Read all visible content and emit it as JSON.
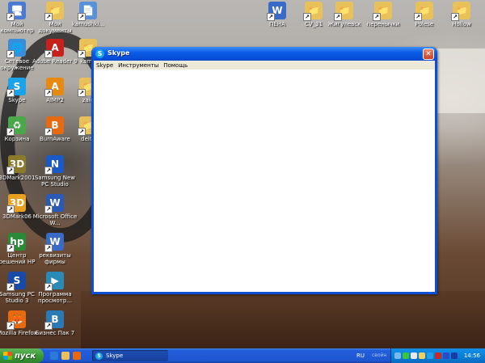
{
  "desktop": {
    "icons": [
      {
        "id": "my-computer",
        "label": "Мой компьютер",
        "glyph": "🖥",
        "color": "#4a7bd0"
      },
      {
        "id": "my-documents",
        "label": "Мои документы",
        "glyph": "📁",
        "color": "#e8c15a"
      },
      {
        "id": "kamushki",
        "label": "kamushki...",
        "glyph": "📄",
        "color": "#5b8fd8"
      },
      {
        "id": "network",
        "label": "Сетевое окружение",
        "glyph": "🌐",
        "color": "#3a8dd8"
      },
      {
        "id": "adobe-reader",
        "label": "Adobe Reader 9",
        "glyph": "A",
        "color": "#c8201a"
      },
      {
        "id": "kamu2",
        "label": "kamu",
        "glyph": "📁",
        "color": "#e8c15a"
      },
      {
        "id": "skype",
        "label": "Skype",
        "glyph": "S",
        "color": "#1aa3e8"
      },
      {
        "id": "aimp2",
        "label": "AIMP2",
        "glyph": "A",
        "color": "#e88a10"
      },
      {
        "id": "zaid",
        "label": "zaid",
        "glyph": "📁",
        "color": "#e8c15a"
      },
      {
        "id": "recycle-bin",
        "label": "Корзина",
        "glyph": "♻",
        "color": "#4aa84a"
      },
      {
        "id": "burnaware",
        "label": "BurnAware",
        "glyph": "B",
        "color": "#e86a10"
      },
      {
        "id": "deita",
        "label": "deita",
        "glyph": "📁",
        "color": "#e8c15a"
      },
      {
        "id": "3dmark2001",
        "label": "3DMark2001",
        "glyph": "3D",
        "color": "#8a7a2a"
      },
      {
        "id": "samsung-new",
        "label": "Samsung New PC Studio",
        "glyph": "N",
        "color": "#1a5ac8"
      },
      {
        "id": "3dmark06",
        "label": "3DMark06",
        "glyph": "3D",
        "color": "#e8a020"
      },
      {
        "id": "office-word",
        "label": "Microsoft Office W...",
        "glyph": "W",
        "color": "#2a5ab8"
      },
      {
        "id": "hp-center",
        "label": "Центр решений HP",
        "glyph": "hp",
        "color": "#2a8a3a"
      },
      {
        "id": "rekvizity",
        "label": "реквизиты фирмы",
        "glyph": "W",
        "color": "#3a6ac8"
      },
      {
        "id": "samsung-pc-studio3",
        "label": "Samsung PC Studio 3",
        "glyph": "S",
        "color": "#1a4aa8"
      },
      {
        "id": "prosmotr",
        "label": "Программа просмотр...",
        "glyph": "▶",
        "color": "#2a8ab8"
      },
      {
        "id": "firefox",
        "label": "Mozilla Firefox",
        "glyph": "🦊",
        "color": "#e86a10"
      },
      {
        "id": "biznes-pack",
        "label": "Бизнес Пак 7",
        "glyph": "B",
        "color": "#2a7ab8"
      },
      {
        "id": "pena",
        "label": "ПЕНА",
        "glyph": "W",
        "color": "#3a6ac8"
      },
      {
        "id": "sv31",
        "label": "CV_31",
        "glyph": "📁",
        "color": "#e8c15a"
      },
      {
        "id": "zhigulevsk",
        "label": "Жигулевск",
        "glyph": "📁",
        "color": "#e8c15a"
      },
      {
        "id": "perenychki",
        "label": "перенычки",
        "glyph": "📁",
        "color": "#e8c15a"
      },
      {
        "id": "polese",
        "label": "Polese",
        "glyph": "📁",
        "color": "#e8c15a"
      },
      {
        "id": "hollow",
        "label": "Hollow",
        "glyph": "📁",
        "color": "#e8c15a"
      }
    ]
  },
  "window": {
    "title": "Skype",
    "close_glyph": "✕",
    "menu": [
      "Skype",
      "Инструменты",
      "Помощь"
    ]
  },
  "taskbar": {
    "start_label": "пуск",
    "task_label": "Skype",
    "language": "RU",
    "language_state": "свойн",
    "clock": "14:56"
  }
}
